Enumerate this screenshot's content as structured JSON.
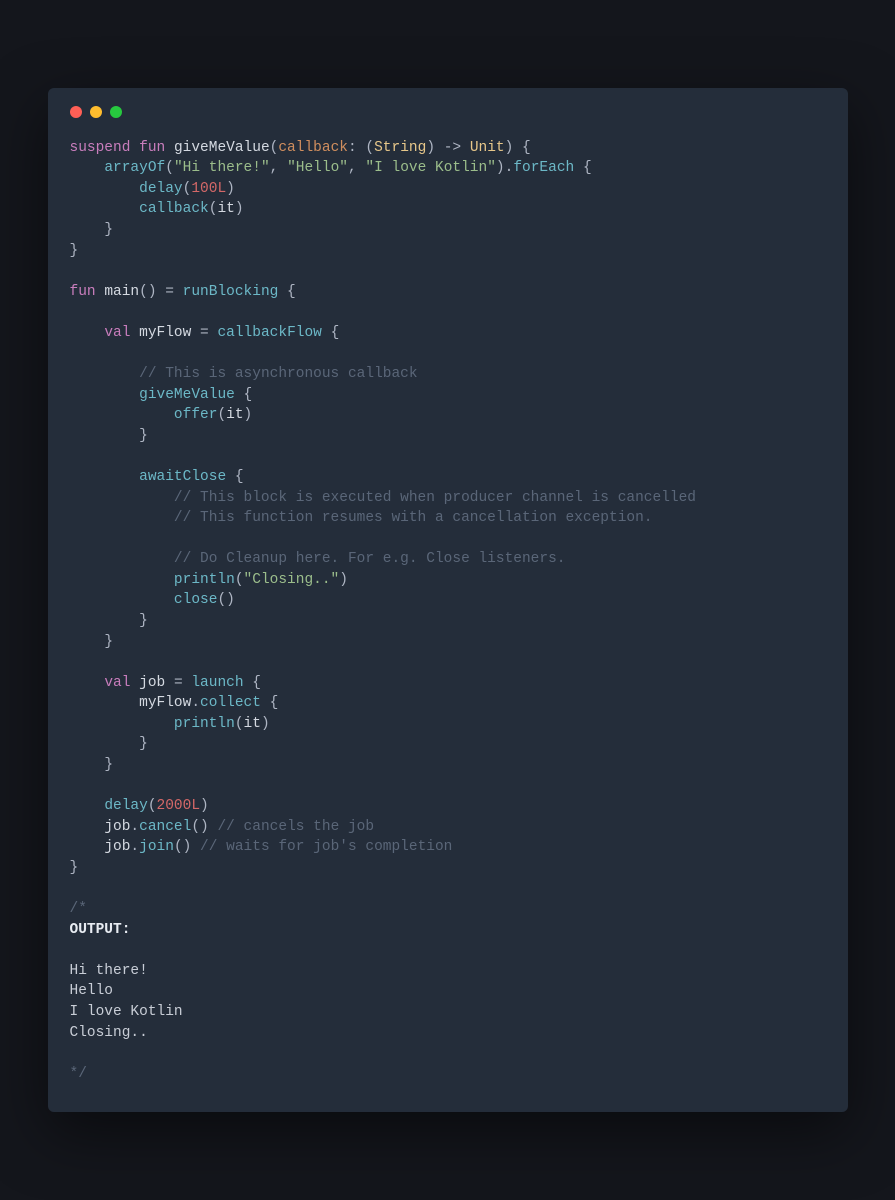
{
  "tokens": {
    "suspend": "suspend",
    "fun": "fun",
    "val": "val",
    "giveMeValue": "giveMeValue",
    "callback": "callback",
    "String": "String",
    "Unit": "Unit",
    "arrayOf": "arrayOf",
    "str_hi": "\"Hi there!\"",
    "str_hello": "\"Hello\"",
    "str_kotlin": "\"I love Kotlin\"",
    "forEach": "forEach",
    "delay": "delay",
    "num_100L": "100L",
    "callback_call": "callback",
    "it": "it",
    "main": "main",
    "runBlocking": "runBlocking",
    "myFlow": "myFlow",
    "callbackFlow": "callbackFlow",
    "comment_async": "// This is asynchronous callback",
    "offer": "offer",
    "awaitClose": "awaitClose",
    "comment_block1": "// This block is executed when producer channel is cancelled",
    "comment_block2": "// This function resumes with a cancellation exception.",
    "comment_cleanup": "// Do Cleanup here. For e.g. Close listeners.",
    "println": "println",
    "str_closing": "\"Closing..\"",
    "close": "close",
    "job": "job",
    "launch": "launch",
    "collect": "collect",
    "num_2000L": "2000L",
    "cancel": "cancel",
    "comment_cancels": "// cancels the job",
    "join": "join",
    "comment_waits": "// waits for job's completion",
    "comment_open": "/*",
    "output_label": "OUTPUT:",
    "out1": "Hi there!",
    "out2": "Hello",
    "out3": "I love Kotlin",
    "out4": "Closing..",
    "comment_close": "*/"
  },
  "colors": {
    "bg_outer": "#14161c",
    "bg_window": "#242d3a",
    "dot_red": "#ff5f56",
    "dot_yellow": "#ffbd2e",
    "dot_green": "#27c93f"
  }
}
